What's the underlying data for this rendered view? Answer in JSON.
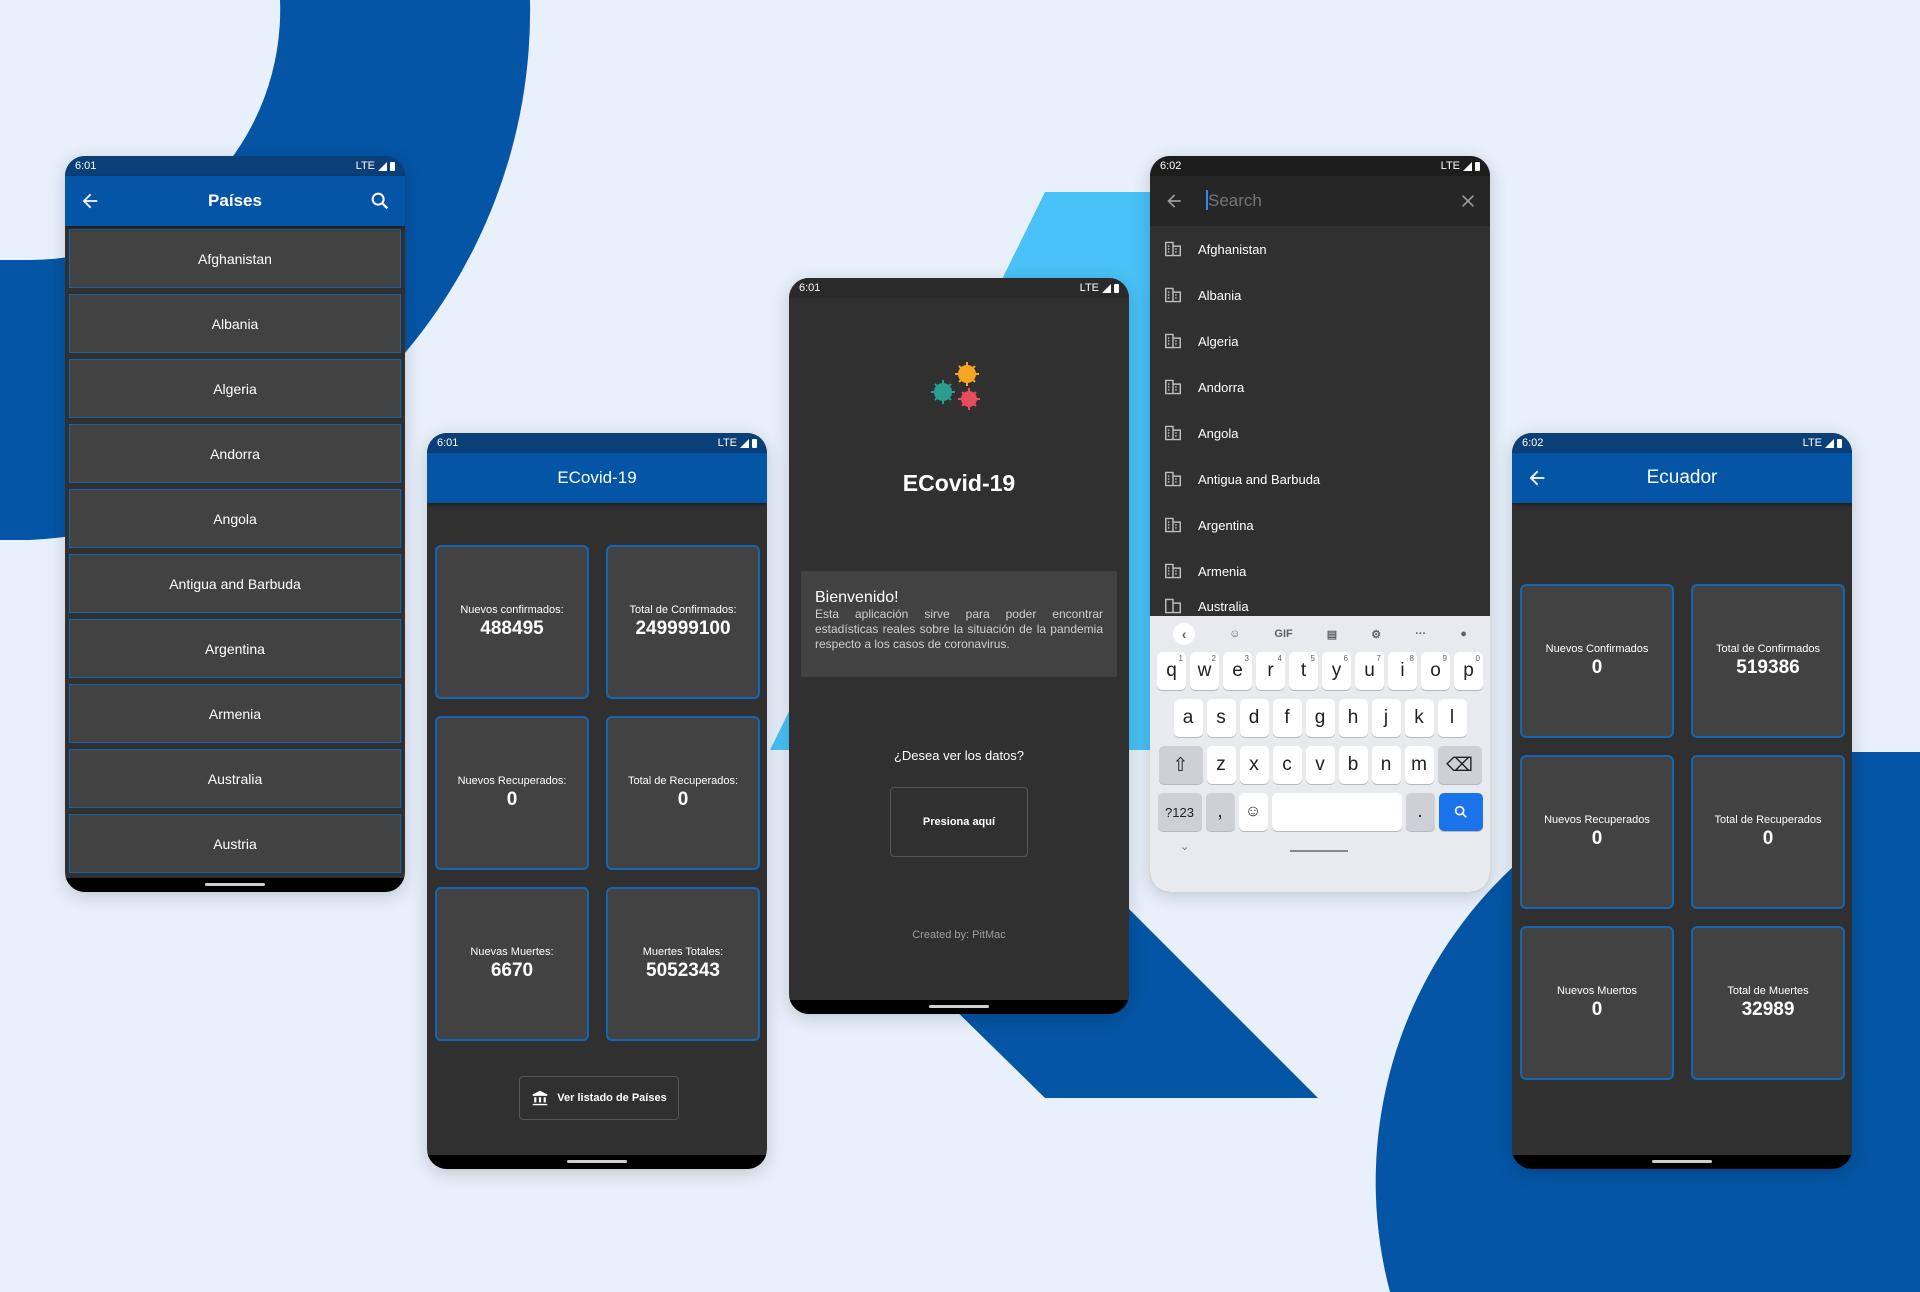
{
  "status": {
    "time_601": "6:01",
    "time_602": "6:02",
    "network": "LTE"
  },
  "phone1": {
    "title": "Países",
    "countries": [
      "Afghanistan",
      "Albania",
      "Algeria",
      "Andorra",
      "Angola",
      "Antigua and Barbuda",
      "Argentina",
      "Armenia",
      "Australia",
      "Austria"
    ]
  },
  "phone2": {
    "title": "ECovid-19",
    "cards": [
      {
        "label": "Nuevos confirmados:",
        "value": "488495"
      },
      {
        "label": "Total de Confirmados:",
        "value": "249999100"
      },
      {
        "label": "Nuevos Recuperados:",
        "value": "0"
      },
      {
        "label": "Total de Recuperados:",
        "value": "0"
      },
      {
        "label": "Nuevas Muertes:",
        "value": "6670"
      },
      {
        "label": "Muertes Totales:",
        "value": "5052343"
      }
    ],
    "list_button": "Ver listado de Países"
  },
  "phone3": {
    "title": "ECovid-19",
    "welcome_heading": "Bienvenido!",
    "welcome_text": "Esta aplicación sirve para poder encontrar estadísticas reales sobre la situación de la pandemia respecto a los casos de coronavirus.",
    "question": "¿Desea ver los datos?",
    "button": "Presiona aquí",
    "footer": "Created by: PitMac"
  },
  "phone4": {
    "search_placeholder": "Search",
    "suggestions": [
      "Afghanistan",
      "Albania",
      "Algeria",
      "Andorra",
      "Angola",
      "Antigua and Barbuda",
      "Argentina",
      "Armenia",
      "Australia"
    ],
    "kb_toolbar": {
      "gif": "GIF",
      "more": "···"
    },
    "row1": [
      [
        "q",
        "1"
      ],
      [
        "w",
        "2"
      ],
      [
        "e",
        "3"
      ],
      [
        "r",
        "4"
      ],
      [
        "t",
        "5"
      ],
      [
        "y",
        "6"
      ],
      [
        "u",
        "7"
      ],
      [
        "i",
        "8"
      ],
      [
        "o",
        "9"
      ],
      [
        "p",
        "0"
      ]
    ],
    "row2": [
      "a",
      "s",
      "d",
      "f",
      "g",
      "h",
      "j",
      "k",
      "l"
    ],
    "row3": [
      "z",
      "x",
      "c",
      "v",
      "b",
      "n",
      "m"
    ],
    "symbols_key": "?123",
    "comma": ",",
    "period": "."
  },
  "phone5": {
    "title": "Ecuador",
    "cards": [
      {
        "label": "Nuevos Confirmados",
        "value": "0"
      },
      {
        "label": "Total de Confirmados",
        "value": "519386"
      },
      {
        "label": "Nuevos Recuperados",
        "value": "0"
      },
      {
        "label": "Total de Recuperados",
        "value": "0"
      },
      {
        "label": "Nuevos Muertos",
        "value": "0"
      },
      {
        "label": "Total de Muertes",
        "value": "32989"
      }
    ]
  },
  "colors": {
    "background": "#e8f0fb",
    "brand_blue": "#0455a5",
    "light_blue": "#49c2f7",
    "surface": "#303030",
    "card": "#424242"
  }
}
